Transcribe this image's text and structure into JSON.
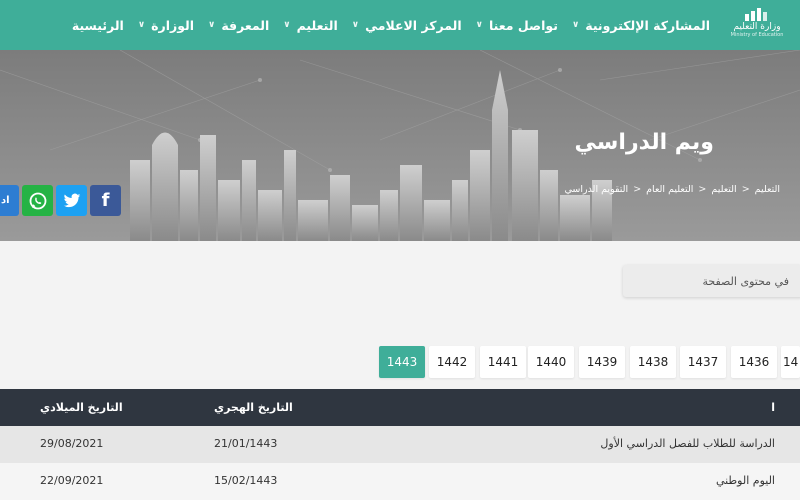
{
  "nav": {
    "items": [
      {
        "label": "الرئيسية",
        "chevron": false
      },
      {
        "label": "الوزارة",
        "chevron": true
      },
      {
        "label": "المعرفة",
        "chevron": true
      },
      {
        "label": "التعليم",
        "chevron": true
      },
      {
        "label": "المركز الاعلامي",
        "chevron": true
      },
      {
        "label": "تواصل معنا",
        "chevron": true
      },
      {
        "label": "المشاركة الإلكترونية",
        "chevron": true
      }
    ],
    "logo": {
      "text": "وزارة التعليم",
      "sub": "Ministry of Education"
    }
  },
  "hero": {
    "title": "ويم الدراسي",
    "breadcrumb": [
      "التعليم",
      "التعليم",
      "التعليم العام",
      "التقويم الدراسي"
    ]
  },
  "social": {
    "add_label": "اد",
    "facebook_glyph": "f"
  },
  "search": {
    "placeholder": "في محتوى الصفحة"
  },
  "years": {
    "items": [
      "1443",
      "1442",
      "1441",
      "1440",
      "1439",
      "1438",
      "1437",
      "1436",
      "14"
    ],
    "active": "1443"
  },
  "table": {
    "headers": {
      "event": "ا",
      "hijri": "التاريخ الهجري",
      "gregorian": "التاريخ الميلادي"
    },
    "rows": [
      {
        "event": "الدراسة للطلاب للفصل الدراسي الأول",
        "hijri": "21/01/1443",
        "gregorian": "29/08/2021"
      },
      {
        "event": "اليوم الوطني",
        "hijri": "15/02/1443",
        "gregorian": "22/09/2021"
      }
    ]
  },
  "colors": {
    "accent": "#3fae99",
    "header_dark": "#2f3640",
    "whatsapp": "#25b345",
    "twitter": "#1da1f2",
    "facebook": "#3b5998",
    "add": "#2d7dd2"
  }
}
